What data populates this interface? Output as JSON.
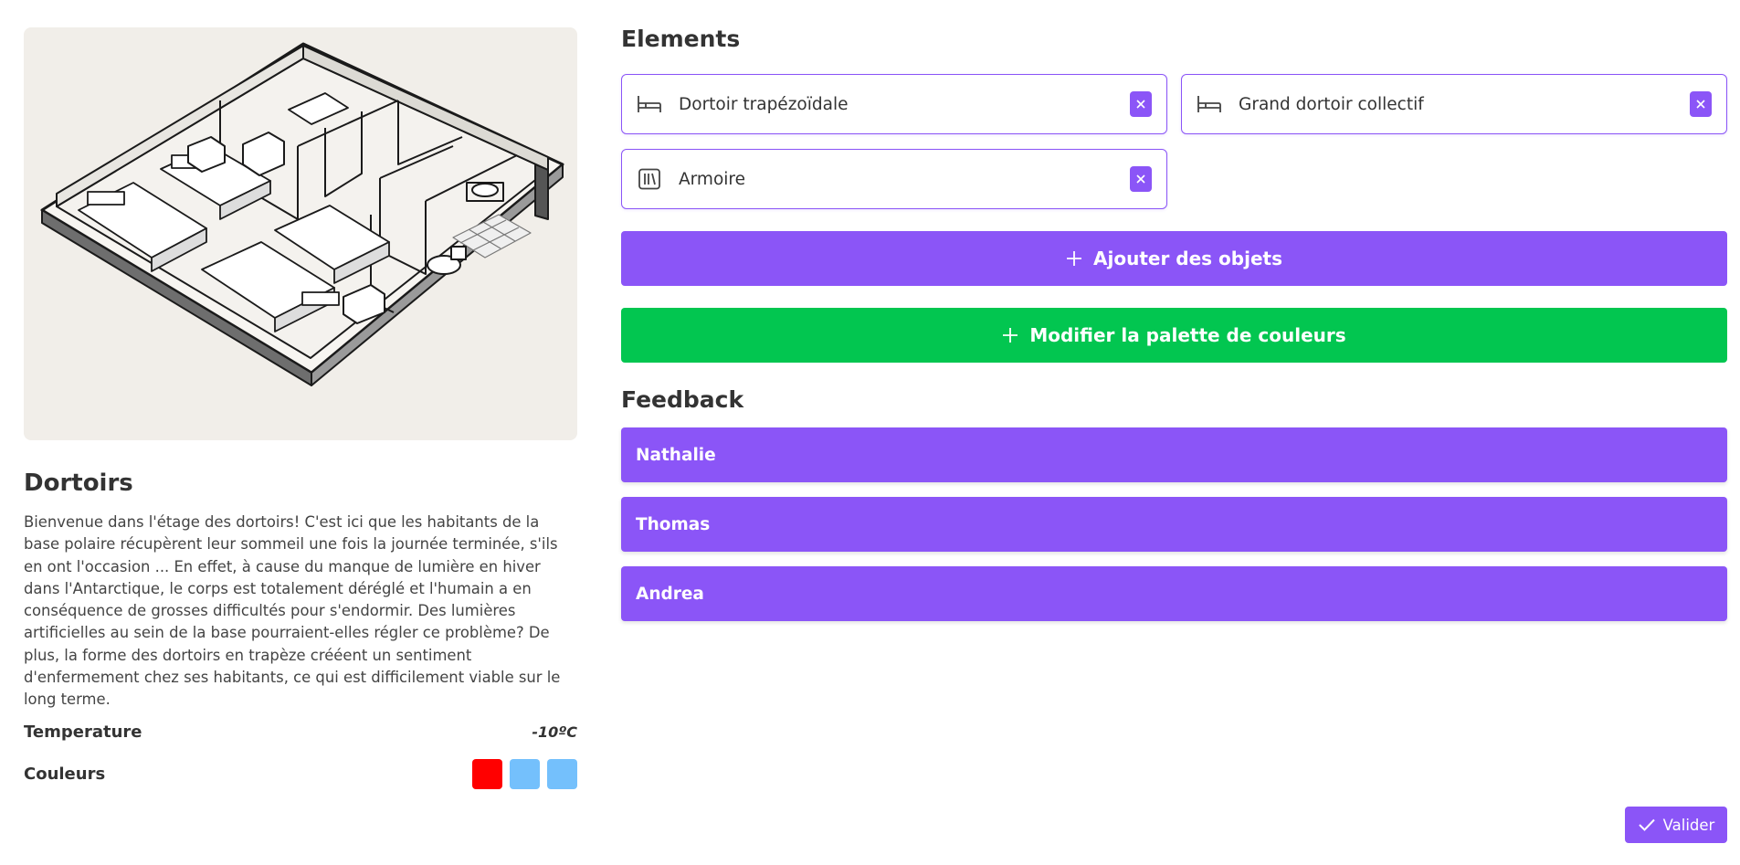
{
  "room": {
    "title": "Dortoirs",
    "description": "Bienvenue dans l'étage des dortoirs! C'est ici que les habitants de la base polaire récupèrent leur sommeil une fois la journée terminée, s'ils en ont l'occasion ... En effet, à cause du manque de lumière en hiver dans l'Antarctique, le corps est totalement déréglé et l'humain a en conséquence de grosses difficultés pour s'endormir. Des lumières artificielles au sein de la base pourraient-elles régler ce problème? De plus, la forme des dortoirs en trapèze crééent un sentiment d'enfermement chez ses habitants, ce qui est difficilement viable sur le long terme.",
    "temperature_label": "Temperature",
    "temperature_value": "-10ºC",
    "colors_label": "Couleurs",
    "colors": [
      "#ff0000",
      "#74c0fc",
      "#74c0fc"
    ]
  },
  "elements": {
    "title": "Elements",
    "items": [
      {
        "label": "Dortoir trapézoïdale",
        "icon": "bed-icon"
      },
      {
        "label": "Grand dortoir collectif",
        "icon": "bed-icon"
      },
      {
        "label": "Armoire",
        "icon": "wardrobe-icon"
      }
    ],
    "add_objects_label": "Ajouter des objets",
    "edit_palette_label": "Modifier la palette de couleurs"
  },
  "feedback": {
    "title": "Feedback",
    "items": [
      "Nathalie",
      "Thomas",
      "Andrea"
    ]
  },
  "validate_label": "Valider",
  "theme": {
    "accent": "#8b55f7",
    "success": "#02c650"
  }
}
